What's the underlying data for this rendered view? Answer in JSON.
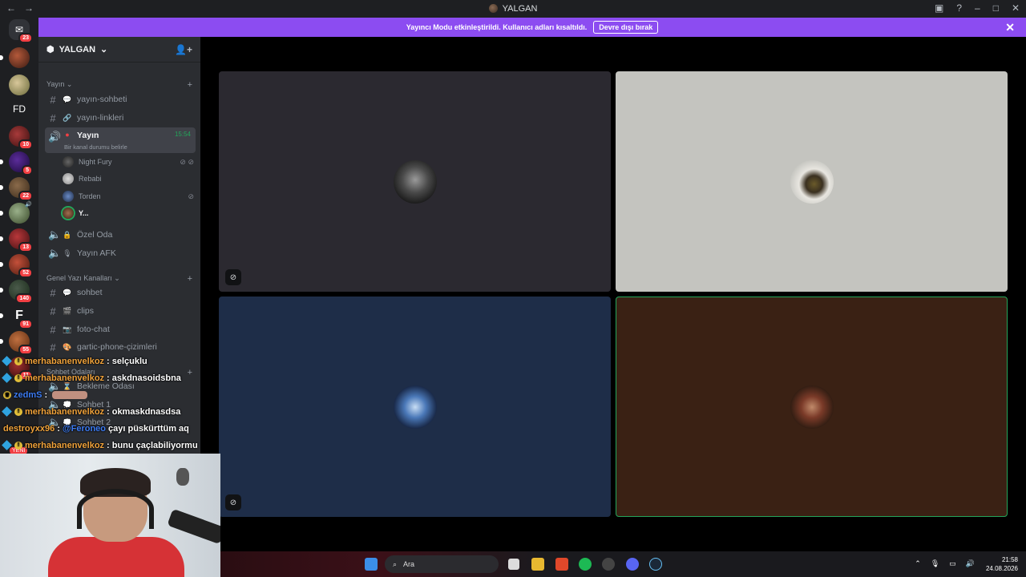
{
  "window": {
    "title": "YALGAN"
  },
  "notice": {
    "text": "Yayıncı Modu etkinleştirildi. Kullanıcı adları kısaltıldı.",
    "button": "Devre dışı bırak"
  },
  "rail": {
    "dm_badge": "23",
    "fd_label": "FD",
    "badges": [
      "10",
      "5",
      "22",
      "13",
      "52",
      "140",
      "91",
      "55",
      "11"
    ],
    "new_label": "YENİ"
  },
  "server": {
    "name": "YALGAN"
  },
  "sidebar": {
    "cat_yayin": "Yayın",
    "ch_sohbeti": "yayın-sohbeti",
    "ch_linkleri": "yayın-linkleri",
    "voice_active": "Yayın",
    "voice_active_time": "15:54",
    "voice_active_status": "Bir kanal durumu belirle",
    "users": [
      "Night Fury",
      "Rebabi",
      "Torden",
      "Y..."
    ],
    "ch_ozel": "Özel Oda",
    "ch_afk": "Yayın AFK",
    "cat_genel": "Genel Yazı Kanalları",
    "ch_sohbet": "sohbet",
    "ch_clips": "clips",
    "ch_foto": "foto-chat",
    "ch_gartic": "gartic-phone-çizimleri",
    "cat_sohbet_odalari": "Sohbet Odaları",
    "ch_bekleme": "Bekleme Odası",
    "ch_sohbet1": "Sohbet 1",
    "ch_sohbet2": "Sohbet 2"
  },
  "chat": [
    {
      "nick": "merhabanenvelkoz",
      "text": "selçuklu"
    },
    {
      "nick": "merhabanenvelkoz",
      "text": "askdnasoidsbna"
    },
    {
      "nick": "zedmS",
      "text": ""
    },
    {
      "nick": "merhabanenvelkoz",
      "text": "okmaskdnasdsa"
    },
    {
      "nick": "destroyxx96",
      "mention": "@Feroneo",
      "text": "çayı püskürttüm aq"
    },
    {
      "nick": "merhabanenvelkoz",
      "text": "bunu çaçlabiliyormu"
    }
  ],
  "taskbar": {
    "search_placeholder": "Ara",
    "time": "21:58",
    "date": "24.08.2026"
  },
  "colors": {
    "accent": "#8c4cf1",
    "speaking": "#23a55a",
    "tile1": "#2b2930",
    "tile2": "#c4c4bf",
    "tile3": "#1e2d48",
    "tile4": "#3a2114"
  }
}
